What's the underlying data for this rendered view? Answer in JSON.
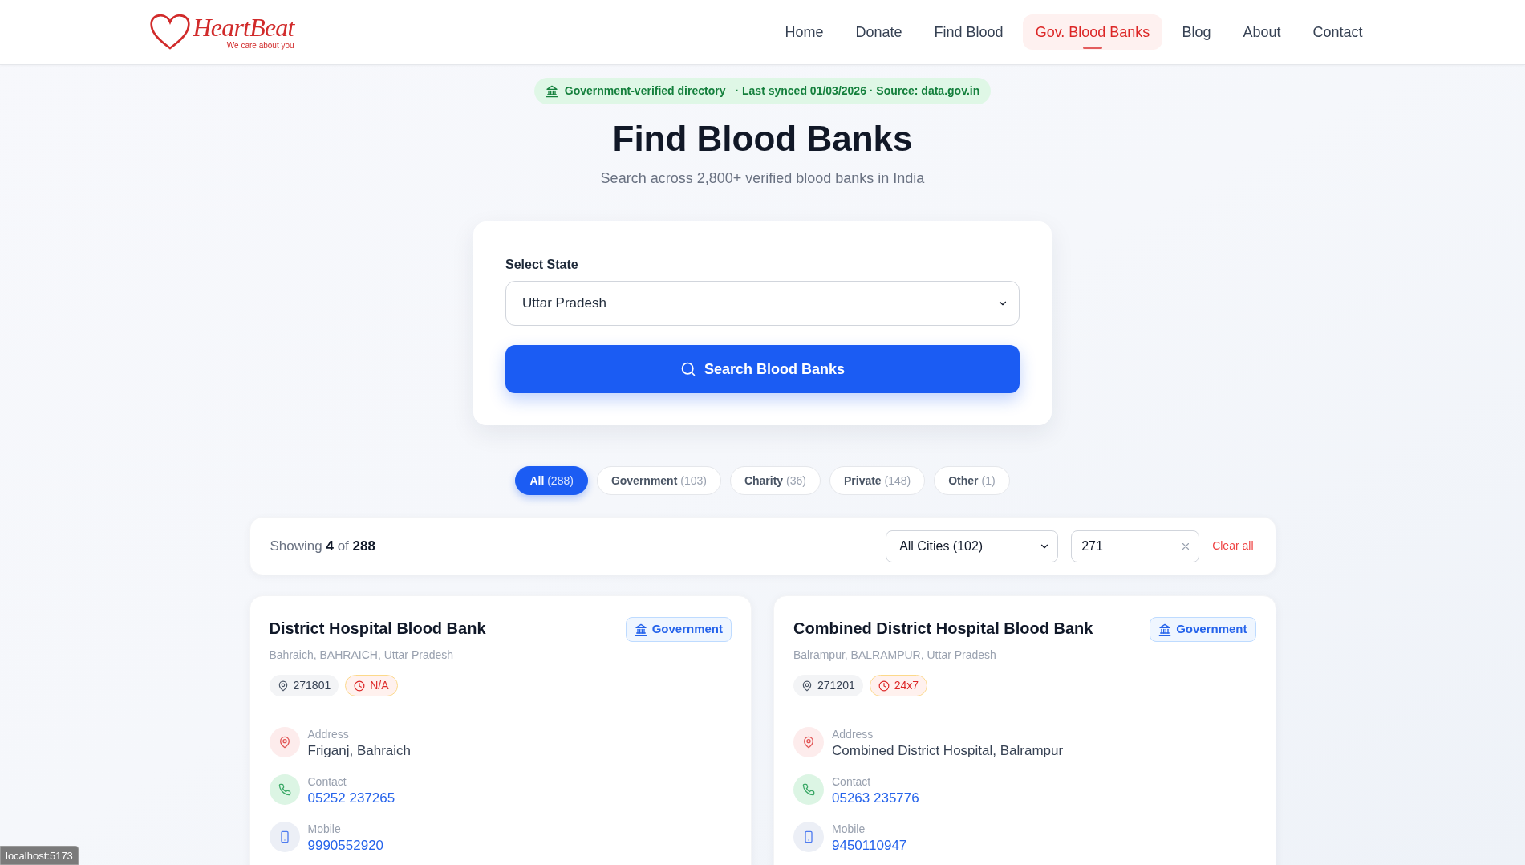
{
  "header": {
    "logo": {
      "name": "HeartBeat",
      "tagline": "We care about you"
    },
    "nav": [
      {
        "label": "Home",
        "selected": false
      },
      {
        "label": "Donate",
        "selected": false
      },
      {
        "label": "Find Blood",
        "selected": false
      },
      {
        "label": "Gov. Blood Banks",
        "selected": true
      },
      {
        "label": "Blog",
        "selected": false
      },
      {
        "label": "About",
        "selected": false
      },
      {
        "label": "Contact",
        "selected": false
      }
    ]
  },
  "hero": {
    "badge": {
      "label": "Government-verified directory",
      "details": "· Last synced 01/03/2026 · Source: data.gov.in"
    },
    "title": "Find Blood Banks",
    "subtitle": "Search across 2,800+ verified blood banks in India"
  },
  "search_card": {
    "state_label": "Select State",
    "state_value": "Uttar Pradesh",
    "button": "Search Blood Banks"
  },
  "filters": [
    {
      "label": "All",
      "count": "(288)",
      "selected": true
    },
    {
      "label": "Government",
      "count": "(103)",
      "selected": false
    },
    {
      "label": "Charity",
      "count": "(36)",
      "selected": false
    },
    {
      "label": "Private",
      "count": "(148)",
      "selected": false
    },
    {
      "label": "Other",
      "count": "(1)",
      "selected": false
    }
  ],
  "results_bar": {
    "showing": "Showing **4** of **288**",
    "city_filter": "All Cities (102)",
    "pincode_value": "271",
    "clear": "Clear all"
  },
  "cards": [
    {
      "name": "District Hospital Blood Bank",
      "location": "Bahraich, BAHRAICH, Uttar Pradesh",
      "pincode": "271801",
      "hours": "N/A",
      "category": "Government",
      "fields": [
        {
          "kind": "address",
          "label": "Address",
          "value": "Friganj, Bahraich"
        },
        {
          "kind": "phone",
          "label": "Contact",
          "value": "05252 237265"
        },
        {
          "kind": "mobile",
          "label": "Mobile",
          "value": "9990552920"
        }
      ]
    },
    {
      "name": "Combined District Hospital Blood Bank",
      "location": "Balrampur, BALRAMPUR, Uttar Pradesh",
      "pincode": "271201",
      "hours": "24x7",
      "category": "Government",
      "fields": [
        {
          "kind": "address",
          "label": "Address",
          "value": "Combined District Hospital, Balrampur"
        },
        {
          "kind": "phone",
          "label": "Contact",
          "value": "05263 235776"
        },
        {
          "kind": "mobile",
          "label": "Mobile",
          "value": "9450110947"
        }
      ]
    }
  ],
  "status_url": "localhost:5173"
}
